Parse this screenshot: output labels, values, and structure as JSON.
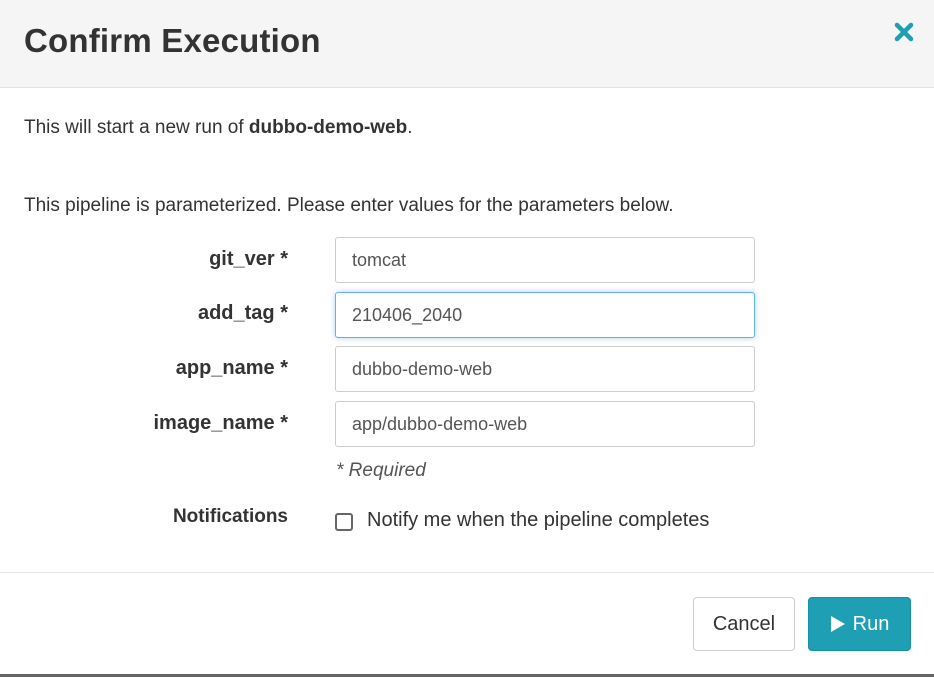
{
  "dialog": {
    "title": "Confirm Execution"
  },
  "body": {
    "intro_prefix": "This will start a new run of ",
    "pipeline_name": "dubbo-demo-web",
    "intro_suffix": ".",
    "param_description": "This pipeline is parameterized. Please enter values for the parameters below."
  },
  "params": [
    {
      "label": "git_ver *",
      "value": "tomcat"
    },
    {
      "label": "add_tag *",
      "value": "210406_2040"
    },
    {
      "label": "app_name *",
      "value": "dubbo-demo-web"
    },
    {
      "label": "image_name *",
      "value": "app/dubbo-demo-web"
    }
  ],
  "required_note": "* Required",
  "notifications": {
    "label": "Notifications",
    "checkbox_text": "Notify me when the pipeline completes",
    "checked": false
  },
  "footer": {
    "cancel_label": "Cancel",
    "run_label": "Run"
  },
  "colors": {
    "accent": "#1e9fb4",
    "close_icon": "#1e9fb4",
    "focus_border": "#66afe9"
  },
  "icons": {
    "close": "close-icon",
    "run": "play-icon"
  }
}
